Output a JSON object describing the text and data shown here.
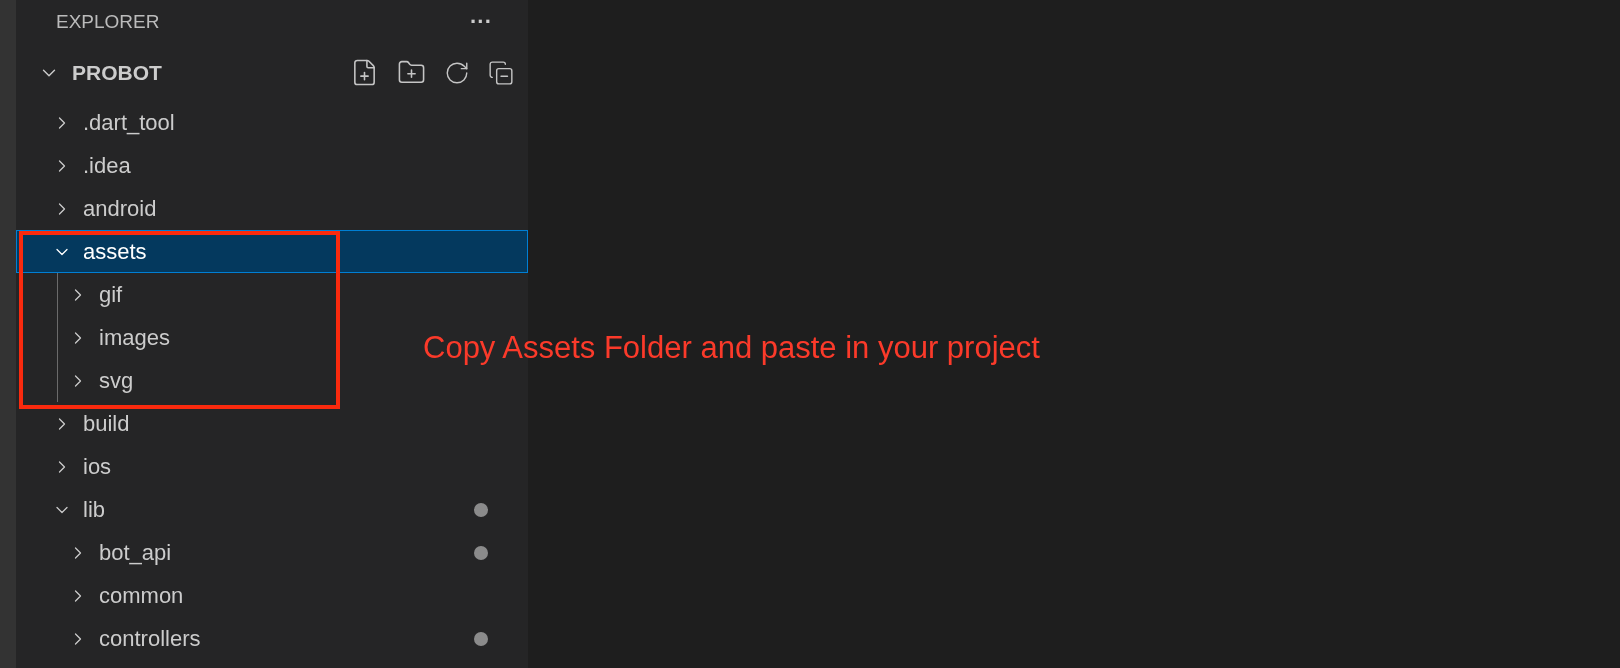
{
  "explorer": {
    "title": "EXPLORER",
    "more": "···"
  },
  "project": {
    "name": "PROBOT",
    "expanded": true
  },
  "tree": [
    {
      "name": ".dart_tool",
      "expanded": false,
      "selected": false,
      "modified": false
    },
    {
      "name": ".idea",
      "expanded": false,
      "selected": false,
      "modified": false
    },
    {
      "name": "android",
      "expanded": false,
      "selected": false,
      "modified": false
    },
    {
      "name": "assets",
      "expanded": true,
      "selected": true,
      "modified": false,
      "children": [
        {
          "name": "gif",
          "expanded": false,
          "selected": false,
          "modified": false
        },
        {
          "name": "images",
          "expanded": false,
          "selected": false,
          "modified": false
        },
        {
          "name": "svg",
          "expanded": false,
          "selected": false,
          "modified": false
        }
      ]
    },
    {
      "name": "build",
      "expanded": false,
      "selected": false,
      "modified": false
    },
    {
      "name": "ios",
      "expanded": false,
      "selected": false,
      "modified": false
    },
    {
      "name": "lib",
      "expanded": true,
      "selected": false,
      "modified": true,
      "children": [
        {
          "name": "bot_api",
          "expanded": false,
          "selected": false,
          "modified": true
        },
        {
          "name": "common",
          "expanded": false,
          "selected": false,
          "modified": false
        },
        {
          "name": "controllers",
          "expanded": false,
          "selected": false,
          "modified": true
        }
      ]
    }
  ],
  "annotation": {
    "text": "Copy Assets Folder and paste in your project"
  }
}
